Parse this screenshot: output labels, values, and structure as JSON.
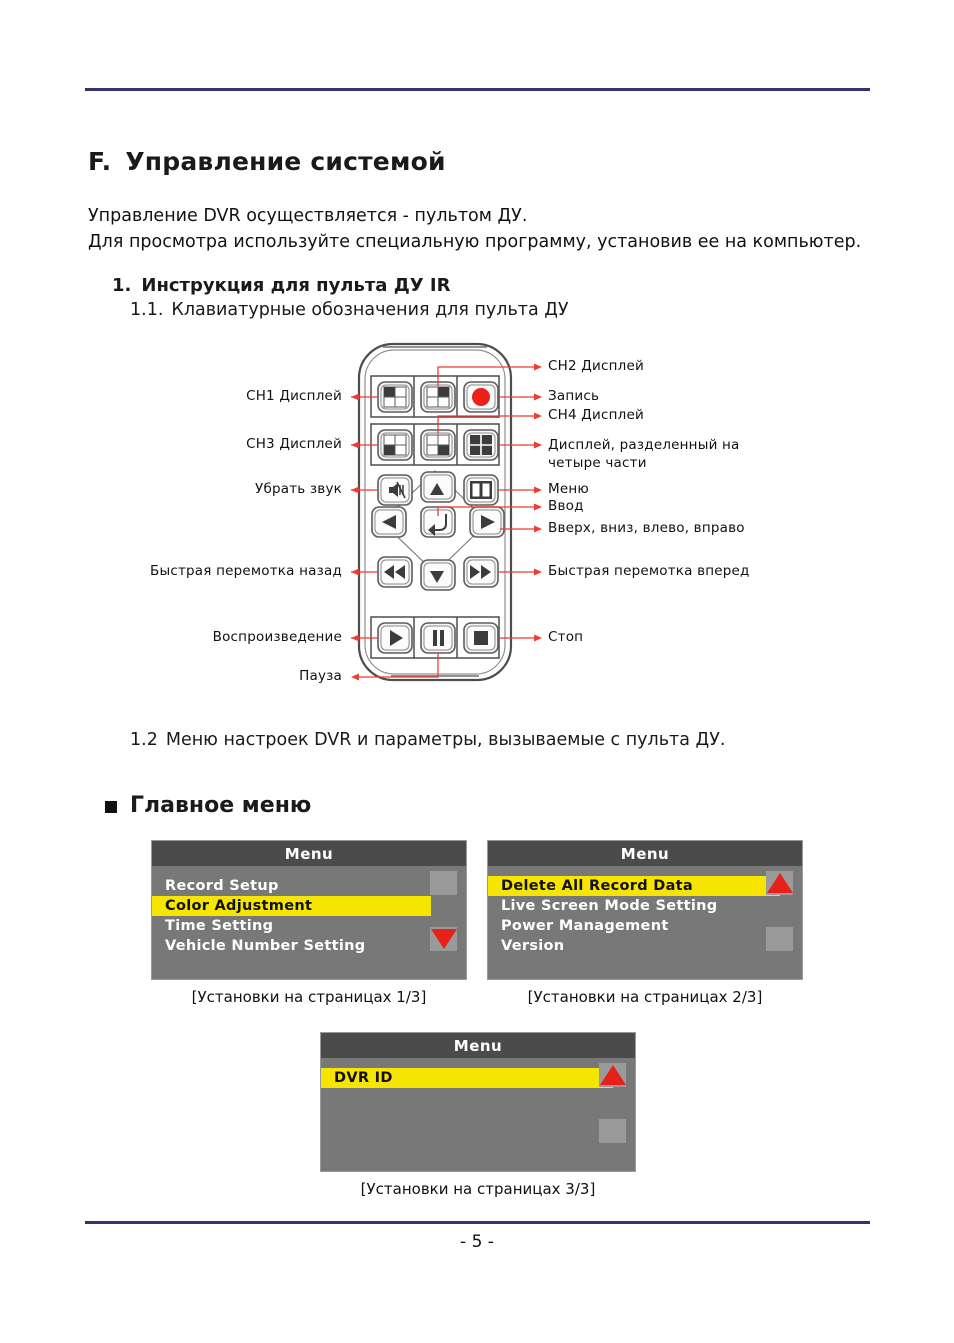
{
  "page": {
    "footer_page_label": "- 5 -"
  },
  "headings": {
    "section_letter": "F.",
    "section_title": "Управление системой",
    "item1_num": "1.",
    "item1_text": "Инструкция для пульта ДУ IR",
    "item11_num": "1.1.",
    "item11_text": "Клавиатурные обозначения для пульта ДУ",
    "item12_num": "1.2",
    "item12_text": "Меню настроек DVR и параметры, вызываемые с пульта ДУ.",
    "main_menu": "Главное меню"
  },
  "intro": {
    "line1": "Управление DVR осуществляется - пультом ДУ.",
    "line2": "Для просмотра используйте специальную программу, установив ее на компьютер."
  },
  "remote": {
    "labels_left": [
      {
        "id": "ch1-display",
        "text": "CH1   Дисплей"
      },
      {
        "id": "ch3-display",
        "text": "CH3  Дисплей"
      },
      {
        "id": "mute",
        "text": "Убрать  звук"
      },
      {
        "id": "rewind",
        "text": "Быстрая  перемотка  назад"
      },
      {
        "id": "play",
        "text": "Воспроизведение"
      },
      {
        "id": "pause",
        "text": "Пауза"
      }
    ],
    "labels_right": [
      {
        "id": "ch2-display",
        "text": "CH2  Дисплей"
      },
      {
        "id": "record",
        "text": "Запись"
      },
      {
        "id": "ch4-display",
        "text": "CH4  Дисплей"
      },
      {
        "id": "quad-display",
        "text": "Дисплей,  разделенный  на четыре  части"
      },
      {
        "id": "menu",
        "text": "Меню"
      },
      {
        "id": "enter",
        "text": "Ввод"
      },
      {
        "id": "directions",
        "text": "Вверх,  вниз,  влево,  вправо"
      },
      {
        "id": "fast-forward",
        "text": "Быстрая  перемотка  вперед"
      },
      {
        "id": "stop",
        "text": "Стоп"
      }
    ]
  },
  "colors": {
    "rule": "#33336e",
    "menu_header_bg": "#4b4b4b",
    "menu_body_bg": "#787878",
    "highlight_yellow": "#f5e500",
    "arrow_red": "#e8201a",
    "callout_red": "#ee3b33"
  },
  "menus": [
    {
      "title": "Menu",
      "caption": "[Установки на страницах 1/3]",
      "scroll_arrow": "down",
      "items": [
        {
          "label": "Record Setup",
          "selected": false
        },
        {
          "label": "Color Adjustment",
          "selected": true
        },
        {
          "label": "Time Setting",
          "selected": false
        },
        {
          "label": "Vehicle Number Setting",
          "selected": false
        }
      ]
    },
    {
      "title": "Menu",
      "caption": "[Установки на страницах 2/3]",
      "scroll_arrow": "up",
      "items": [
        {
          "label": "Delete All Record Data",
          "selected": true
        },
        {
          "label": "Live Screen Mode Setting",
          "selected": false
        },
        {
          "label": "Power Management",
          "selected": false
        },
        {
          "label": "Version",
          "selected": false
        }
      ]
    },
    {
      "title": "Menu",
      "caption": "[Установки на страницах 3/3]",
      "scroll_arrow": "up",
      "items": [
        {
          "label": "DVR ID",
          "selected": true
        }
      ]
    }
  ]
}
